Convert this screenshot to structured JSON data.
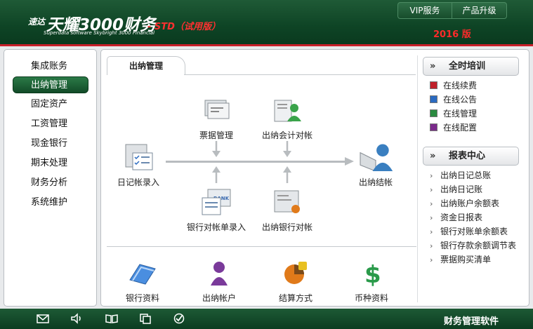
{
  "header": {
    "logo_prefix": "速达",
    "logo_title": "天耀3000财务",
    "logo_edition": "- STD（试用版）",
    "logo_subtitle": "Superdata software Skybright 3000 Financial",
    "menu": [
      "VIP服务",
      "产品升级"
    ],
    "year": "2016 版"
  },
  "sidebar": {
    "items": [
      {
        "label": "集成账务",
        "active": false
      },
      {
        "label": "出纳管理",
        "active": true
      },
      {
        "label": "固定资产",
        "active": false
      },
      {
        "label": "工资管理",
        "active": false
      },
      {
        "label": "现金银行",
        "active": false
      },
      {
        "label": "期末处理",
        "active": false
      },
      {
        "label": "财务分析",
        "active": false
      },
      {
        "label": "系统维护",
        "active": false
      }
    ]
  },
  "main": {
    "tab": "出纳管理",
    "flow": {
      "piaoju": "票据管理",
      "chuna_kuaiji": "出纳会计对帐",
      "rijizhang": "日记帐录入",
      "chuna_jiezhang": "出纳结帐",
      "yinhang_duizhangdan": "银行对帐单录入",
      "chuna_yinhang": "出纳银行对帐"
    },
    "bottom": [
      "银行资料",
      "出纳帐户",
      "结算方式",
      "币种资料"
    ]
  },
  "right": {
    "training": {
      "title": "全时培训",
      "items": [
        "在线续费",
        "在线公告",
        "在线管理",
        "在线配置"
      ],
      "colors": [
        "#c0202a",
        "#2a6ac0",
        "#2a8a40",
        "#7a2a8a"
      ]
    },
    "reports": {
      "title": "报表中心",
      "items": [
        "出纳日记总账",
        "出纳日记账",
        "出纳账户余额表",
        "资金日报表",
        "银行对账单余额表",
        "银行存款余额调节表",
        "票据购买清单"
      ]
    }
  },
  "footer": {
    "title": "财务管理软件",
    "icons": [
      "mail-icon",
      "speaker-icon",
      "book-icon",
      "copy-icon",
      "check-icon"
    ]
  }
}
